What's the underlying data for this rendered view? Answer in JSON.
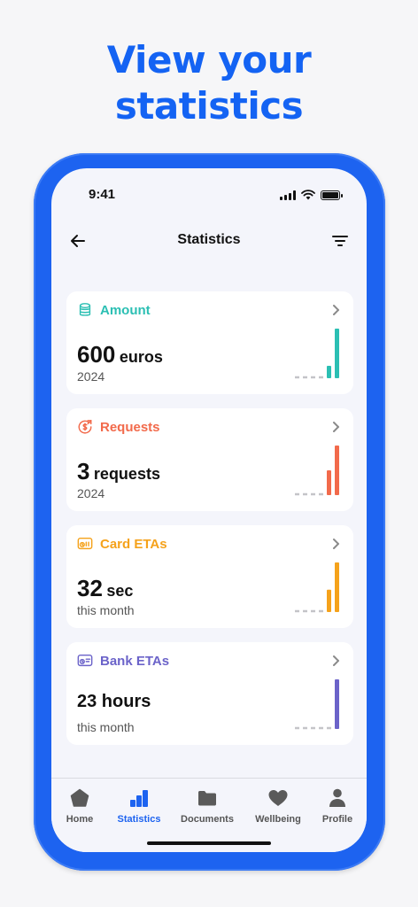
{
  "headline": {
    "line1": "View your",
    "line2": "statistics"
  },
  "status_bar": {
    "time": "9:41"
  },
  "nav": {
    "title": "Statistics"
  },
  "cards": [
    {
      "label": "Amount",
      "value": "600",
      "unit": "euros",
      "sub": "2024",
      "color": "#2bbfb3",
      "icon": "coins-stack-icon",
      "bars": [
        0,
        0,
        0,
        0,
        0.25,
        1
      ]
    },
    {
      "label": "Requests",
      "value": "3",
      "unit": "requests",
      "sub": "2024",
      "color": "#f26a4b",
      "icon": "dollar-cycle-icon",
      "bars": [
        0,
        0,
        0,
        0,
        0.5,
        1
      ]
    },
    {
      "label": "Card ETAs",
      "value": "32",
      "unit": "sec",
      "sub": "this month",
      "color": "#f5a21b",
      "icon": "card-clock-icon",
      "bars": [
        0,
        0,
        0,
        0,
        0.45,
        1
      ]
    },
    {
      "label": "Bank ETAs",
      "value": "23 hours",
      "unit": "",
      "sub": "this month",
      "color": "#6b63c9",
      "icon": "bank-clock-icon",
      "bars": [
        0,
        0,
        0,
        0,
        0,
        1
      ]
    }
  ],
  "tabs": [
    {
      "label": "Home",
      "icon": "home-icon",
      "active": false
    },
    {
      "label": "Statistics",
      "icon": "statistics-icon",
      "active": true
    },
    {
      "label": "Documents",
      "icon": "folder-icon",
      "active": false
    },
    {
      "label": "Wellbeing",
      "icon": "heart-icon",
      "active": false
    },
    {
      "label": "Profile",
      "icon": "person-icon",
      "active": false
    }
  ],
  "colors": {
    "accent": "#1d63f0",
    "headline": "#1463f3",
    "inactive_tab": "#555555"
  }
}
